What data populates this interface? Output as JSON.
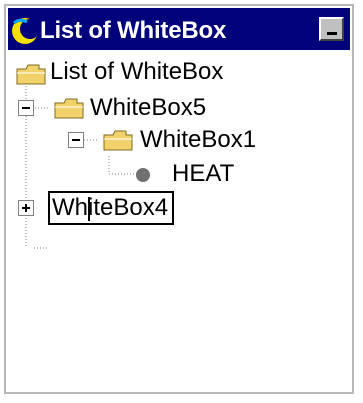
{
  "window": {
    "title": "List of WhiteBox",
    "title_icon": "moon-icon",
    "minimize_icon": "minimize-icon"
  },
  "tree": {
    "root": {
      "label": "List of WhiteBox",
      "icon": "folder-open-icon"
    },
    "nodes": [
      {
        "label": "WhiteBox5",
        "icon": "folder-open-icon",
        "expanded": true
      },
      {
        "label": "WhiteBox1",
        "icon": "folder-open-icon",
        "expanded": true
      },
      {
        "label": "HEAT",
        "icon": "leaf-dot-icon"
      },
      {
        "label": "WhiteBox4",
        "icon": "none",
        "expanded": false,
        "editing": true
      }
    ]
  },
  "colors": {
    "titlebar": "#00017b",
    "folder": "#f2d36b",
    "connector": "#7f7f7f"
  }
}
